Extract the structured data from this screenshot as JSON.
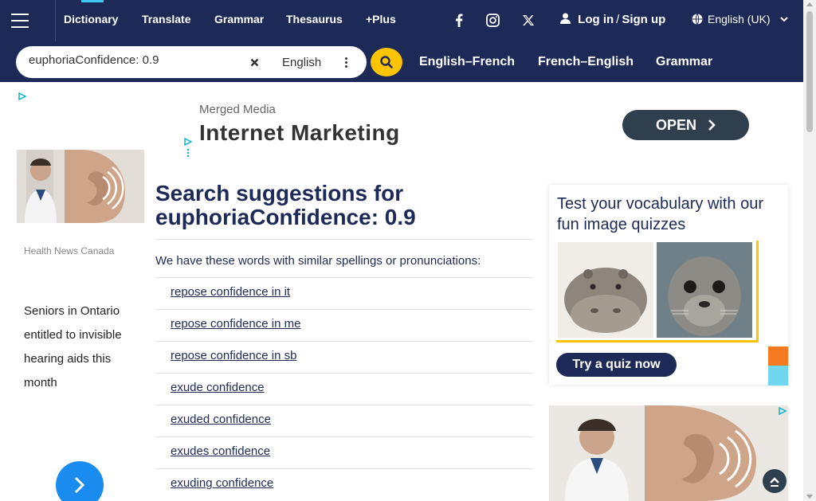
{
  "header": {
    "nav": [
      "Dictionary",
      "Translate",
      "Grammar",
      "Thesaurus",
      "+Plus"
    ],
    "login": "Log in",
    "signup": "Sign up",
    "language": "English (UK)"
  },
  "search": {
    "value": "euphoriaConfidence: 0.9",
    "dictionary": "English",
    "quicklinks": [
      "English–French",
      "French–English",
      "Grammar"
    ]
  },
  "ads": {
    "left": {
      "source": "Health News Canada",
      "text": "Seniors in Ontario entitled to invisible hearing aids this month"
    },
    "banner": {
      "advertiser": "Merged Media",
      "title": "Internet Marketing",
      "cta": "OPEN"
    }
  },
  "main": {
    "heading_prefix": "Search suggestions for",
    "heading_query": "euphoriaConfidence: 0.9",
    "intro": "We have these words with similar spellings or pronunciations:",
    "suggestions": [
      "repose confidence in it",
      "repose confidence in me",
      "repose confidence in sb",
      "exude confidence",
      "exuded confidence",
      "exudes confidence",
      "exuding confidence"
    ]
  },
  "quiz": {
    "title": "Test your vocabulary with our fun image quizzes",
    "button": "Try a quiz now"
  },
  "colors": {
    "brand_navy": "#1d2a57",
    "accent_yellow": "#fec400",
    "ad_blue": "#1a8cf0"
  },
  "icons": [
    "menu-icon",
    "facebook-icon",
    "instagram-icon",
    "x-icon",
    "user-icon",
    "globe-icon",
    "chevron-down-icon",
    "close-icon",
    "more-vertical-icon",
    "search-icon",
    "ad-choices-icon",
    "chevron-right-icon",
    "arrow-up-icon"
  ]
}
